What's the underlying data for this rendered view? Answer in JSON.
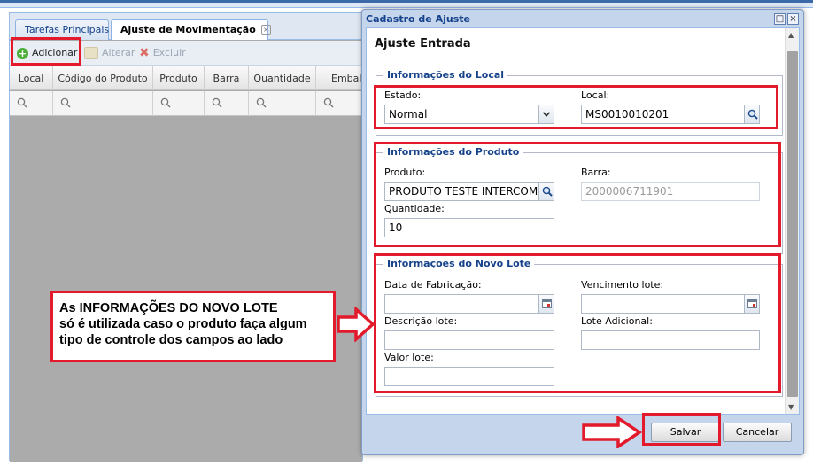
{
  "app": {
    "tabs": [
      {
        "label": "Tarefas Principais"
      },
      {
        "label": "Ajuste de Movimentação"
      }
    ],
    "tab_close_glyph": "×",
    "toolbar": {
      "add_label": "Adicionar",
      "edit_label": "Alterar",
      "delete_label": "Excluir"
    },
    "grid_columns": [
      "Local",
      "Código do Produto",
      "Produto",
      "Barra",
      "Quantidade",
      "Embala"
    ]
  },
  "callout": {
    "lines": [
      "As INFORMAÇÕES DO NOVO LOTE",
      "só é utilizada caso o produto faça algum",
      "tipo de controle dos campos ao lado"
    ]
  },
  "modal": {
    "title": "Cadastro de Ajuste",
    "header": "Ajuste Entrada",
    "local_section": {
      "legend": "Informações do Local",
      "estado_label": "Estado:",
      "estado_value": "Normal",
      "local_label": "Local:",
      "local_value": "MS0010010201"
    },
    "produto_section": {
      "legend": "Informações do Produto",
      "produto_label": "Produto:",
      "produto_value": "PRODUTO TESTE INTERCOMPANY",
      "barra_label": "Barra:",
      "barra_value": "2000006711901",
      "quantidade_label": "Quantidade:",
      "quantidade_value": "10"
    },
    "lote_section": {
      "legend": "Informações do Novo Lote",
      "fabricacao_label": "Data de Fabricação:",
      "fabricacao_value": "",
      "vencimento_label": "Vencimento lote:",
      "vencimento_value": "",
      "descricao_label": "Descrição lote:",
      "descricao_value": "",
      "adicional_label": "Lote Adicional:",
      "adicional_value": "",
      "valor_label": "Valor lote:",
      "valor_value": ""
    },
    "save_label": "Salvar",
    "cancel_label": "Cancelar"
  },
  "colors": {
    "highlight": "#e21a2c",
    "accent": "#15428b"
  }
}
